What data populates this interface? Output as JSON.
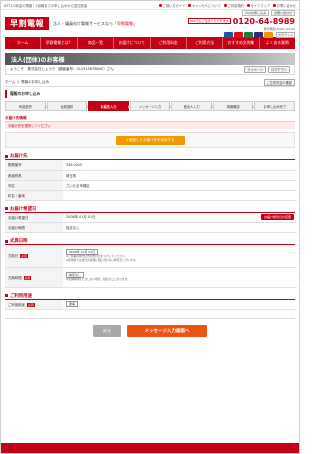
{
  "topstrip": {
    "notice": "NTT1/3利金の電報！1回様までの申し込みから翌日配達",
    "links": [
      "ご使い方ガイド",
      "キャンセルについて",
      "ご利用規約",
      "サイトマップ",
      "お問い合わせ"
    ]
  },
  "header": {
    "logo": "早割電報",
    "tagline_prefix": "法人・議員向け電報サービスなら",
    "tagline_highlight": "「早割電報」",
    "freedial_badge": "FAXでもご注文いただけます",
    "phone": "0120-64-8989",
    "hours": "受付時間 8:00～19:00",
    "font_size_label": "文字サイズ",
    "fax_btn1": "FAXお申し込み",
    "fax_btn2": "お問い合わせ",
    "card_colors": [
      "#1a5ba6",
      "#e30b17",
      "#1c7a3d",
      "#2a2a7a",
      "#f29600"
    ]
  },
  "nav": [
    "ホーム",
    "早割電報とは？",
    "商品一覧",
    "お届けについて",
    "ご利用料金",
    "ご利用方法",
    "おすすめ文例集",
    "よくある質問"
  ],
  "banner": {
    "title": "法人(団体)のお客様"
  },
  "welcome": {
    "text": "ようこそ　株式会社しょうり（顧客番号：012345678890）さん",
    "mypage": "マイページ",
    "logout": "ログアウト"
  },
  "breadcrumb": {
    "text": "ホーム ＞ 電報のお申し込み",
    "chat": "ご意見内容の確認"
  },
  "section_title": "電報のお申し込み",
  "steps": [
    "商品選択",
    "台紙選択",
    "お届先入力",
    "メッセージ入力",
    "差出人入力",
    "電報確認",
    "お申し込み完了"
  ],
  "active_step": 2,
  "delivery_subhead": "お届け先情報",
  "pink_note": "お届け先を選択してください",
  "orange_btn": "＋登録したお届け先を利用する",
  "recipient": {
    "title": "お届け先",
    "rows": [
      {
        "label": "郵便番号",
        "value": "336 0925"
      },
      {
        "label": "都道府県",
        "value": "埼玉県"
      },
      {
        "label": "市区",
        "value": "さいたま市緑区"
      },
      {
        "label": "町名・番地",
        "value": ""
      }
    ]
  },
  "delivery_date": {
    "title": "お届け希望日",
    "rows": [
      {
        "label": "お届け希望日",
        "value": "2008年 01月 01日"
      },
      {
        "label": "お届け時間",
        "value": "指定なし"
      }
    ],
    "btn": "お届け希望日の変更"
  },
  "ceremony": {
    "title": "式典日時",
    "date_label": "式典日",
    "date_value": "2008年 01月 01日",
    "note1": "※ご葬儀の場合は告別式の日を入力してください。",
    "note2": "※年賀状では当日の式典に間に合わない場合がございます。",
    "time_label": "式典時間",
    "time_value": "指定なし",
    "note3": "※式典時間を入力しない場合、指定なしとなります。"
  },
  "usage": {
    "title": "ご利用用途",
    "label": "ご利用用途",
    "value": "慶事"
  },
  "actions": {
    "back": "戻る",
    "next": "メッセージ入力画面へ"
  }
}
